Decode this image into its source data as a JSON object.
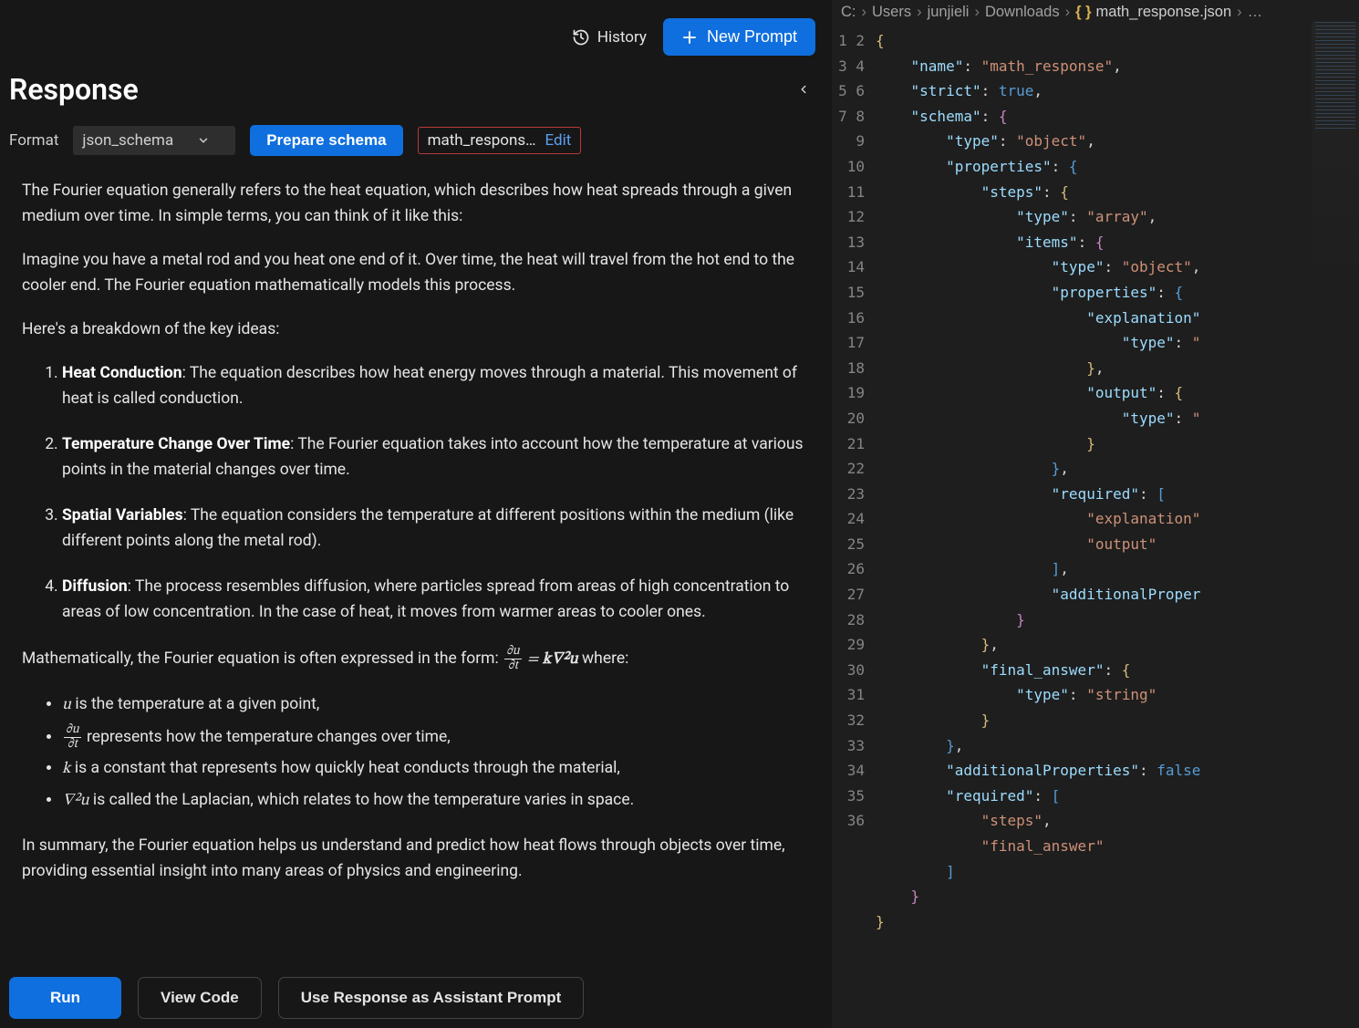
{
  "topbar": {
    "history_label": "History",
    "new_prompt_label": "New Prompt"
  },
  "header": {
    "title": "Response"
  },
  "format": {
    "label": "Format",
    "selected": "json_schema",
    "prepare_label": "Prepare schema",
    "schema_name": "math_respons…",
    "edit_label": "Edit"
  },
  "content": {
    "p1": "The Fourier equation generally refers to the heat equation, which describes how heat spreads through a given medium over time. In simple terms, you can think of it like this:",
    "p2": "Imagine you have a metal rod and you heat one end of it. Over time, the heat will travel from the hot end to the cooler end. The Fourier equation mathematically models this process.",
    "p3": "Here's a breakdown of the key ideas:",
    "items": [
      {
        "bold": "Heat Conduction",
        "rest": ": The equation describes how heat energy moves through a material. This movement of heat is called conduction."
      },
      {
        "bold": "Temperature Change Over Time",
        "rest": ": The Fourier equation takes into account how the temperature at various points in the material changes over time."
      },
      {
        "bold": "Spatial Variables",
        "rest": ": The equation considers the temperature at different positions within the medium (like different points along the metal rod)."
      },
      {
        "bold": "Diffusion",
        "rest": ": The process resembles diffusion, where particles spread from areas of high concentration to areas of low concentration. In the case of heat, it moves from warmer areas to cooler ones."
      }
    ],
    "p4_pre": "Mathematically, the Fourier equation is often expressed in the form: ",
    "p4_post": " where:",
    "eq": {
      "lhs_num": "∂u",
      "lhs_den": "∂t",
      "rhs": "k∇²u"
    },
    "bullets": [
      {
        "pre": "",
        "sym": "u",
        "post": " is the temperature at a given point,"
      },
      {
        "pre": "",
        "frac_num": "∂u",
        "frac_den": "∂t",
        "post": " represents how the temperature changes over time,"
      },
      {
        "pre": "",
        "sym": "k",
        "post": " is a constant that represents how quickly heat conducts through the material,"
      },
      {
        "pre": "",
        "sym": "∇²u",
        "post": " is called the Laplacian, which relates to how the temperature varies in space."
      }
    ],
    "p5": "In summary, the Fourier equation helps us understand and predict how heat flows through objects over time, providing essential insight into many areas of physics and engineering."
  },
  "buttons": {
    "run": "Run",
    "view_code": "View Code",
    "use_response": "Use Response as Assistant Prompt"
  },
  "editor": {
    "breadcrumbs": [
      "C:",
      "Users",
      "junjieli",
      "Downloads"
    ],
    "filename": "math_response.json",
    "trailing": "…",
    "line_count": 36,
    "code_lines": [
      [
        [
          "brace",
          "{"
        ]
      ],
      [
        [
          "sp",
          4
        ],
        [
          "key",
          "\"name\""
        ],
        [
          "punc",
          ": "
        ],
        [
          "str",
          "\"math_response\""
        ],
        [
          "punc",
          ","
        ]
      ],
      [
        [
          "sp",
          4
        ],
        [
          "key",
          "\"strict\""
        ],
        [
          "punc",
          ": "
        ],
        [
          "bool",
          "true"
        ],
        [
          "punc",
          ","
        ]
      ],
      [
        [
          "sp",
          4
        ],
        [
          "key",
          "\"schema\""
        ],
        [
          "punc",
          ": "
        ],
        [
          "brace2",
          "{"
        ]
      ],
      [
        [
          "sp",
          8
        ],
        [
          "key",
          "\"type\""
        ],
        [
          "punc",
          ": "
        ],
        [
          "str",
          "\"object\""
        ],
        [
          "punc",
          ","
        ]
      ],
      [
        [
          "sp",
          8
        ],
        [
          "key",
          "\"properties\""
        ],
        [
          "punc",
          ": "
        ],
        [
          "brace3",
          "{"
        ]
      ],
      [
        [
          "sp",
          12
        ],
        [
          "key",
          "\"steps\""
        ],
        [
          "punc",
          ": "
        ],
        [
          "brace",
          "{"
        ]
      ],
      [
        [
          "sp",
          16
        ],
        [
          "key",
          "\"type\""
        ],
        [
          "punc",
          ": "
        ],
        [
          "str",
          "\"array\""
        ],
        [
          "punc",
          ","
        ]
      ],
      [
        [
          "sp",
          16
        ],
        [
          "key",
          "\"items\""
        ],
        [
          "punc",
          ": "
        ],
        [
          "brace2",
          "{"
        ]
      ],
      [
        [
          "sp",
          20
        ],
        [
          "key",
          "\"type\""
        ],
        [
          "punc",
          ": "
        ],
        [
          "str",
          "\"object\""
        ],
        [
          "punc",
          ","
        ]
      ],
      [
        [
          "sp",
          20
        ],
        [
          "key",
          "\"properties\""
        ],
        [
          "punc",
          ": "
        ],
        [
          "brace3",
          "{"
        ]
      ],
      [
        [
          "sp",
          24
        ],
        [
          "key",
          "\"explanation\""
        ]
      ],
      [
        [
          "sp",
          28
        ],
        [
          "key",
          "\"type\""
        ],
        [
          "punc",
          ": "
        ],
        [
          "str",
          "\""
        ]
      ],
      [
        [
          "sp",
          24
        ],
        [
          "brace",
          "}"
        ],
        [
          "punc",
          ","
        ]
      ],
      [
        [
          "sp",
          24
        ],
        [
          "key",
          "\"output\""
        ],
        [
          "punc",
          ": "
        ],
        [
          "brace",
          "{"
        ]
      ],
      [
        [
          "sp",
          28
        ],
        [
          "key",
          "\"type\""
        ],
        [
          "punc",
          ": "
        ],
        [
          "str",
          "\""
        ]
      ],
      [
        [
          "sp",
          24
        ],
        [
          "brace",
          "}"
        ]
      ],
      [
        [
          "sp",
          20
        ],
        [
          "brace3",
          "}"
        ],
        [
          "punc",
          ","
        ]
      ],
      [
        [
          "sp",
          20
        ],
        [
          "key",
          "\"required\""
        ],
        [
          "punc",
          ": "
        ],
        [
          "brace3",
          "["
        ]
      ],
      [
        [
          "sp",
          24
        ],
        [
          "str",
          "\"explanation\""
        ]
      ],
      [
        [
          "sp",
          24
        ],
        [
          "str",
          "\"output\""
        ]
      ],
      [
        [
          "sp",
          20
        ],
        [
          "brace3",
          "]"
        ],
        [
          "punc",
          ","
        ]
      ],
      [
        [
          "sp",
          20
        ],
        [
          "key",
          "\"additionalProper"
        ]
      ],
      [
        [
          "sp",
          16
        ],
        [
          "brace2",
          "}"
        ]
      ],
      [
        [
          "sp",
          12
        ],
        [
          "brace",
          "}"
        ],
        [
          "punc",
          ","
        ]
      ],
      [
        [
          "sp",
          12
        ],
        [
          "key",
          "\"final_answer\""
        ],
        [
          "punc",
          ": "
        ],
        [
          "brace",
          "{"
        ]
      ],
      [
        [
          "sp",
          16
        ],
        [
          "key",
          "\"type\""
        ],
        [
          "punc",
          ": "
        ],
        [
          "str",
          "\"string\""
        ]
      ],
      [
        [
          "sp",
          12
        ],
        [
          "brace",
          "}"
        ]
      ],
      [
        [
          "sp",
          8
        ],
        [
          "brace3",
          "}"
        ],
        [
          "punc",
          ","
        ]
      ],
      [
        [
          "sp",
          8
        ],
        [
          "key",
          "\"additionalProperties\""
        ],
        [
          "punc",
          ": "
        ],
        [
          "bool",
          "false"
        ]
      ],
      [
        [
          "sp",
          8
        ],
        [
          "key",
          "\"required\""
        ],
        [
          "punc",
          ": "
        ],
        [
          "brace3",
          "["
        ]
      ],
      [
        [
          "sp",
          12
        ],
        [
          "str",
          "\"steps\""
        ],
        [
          "punc",
          ","
        ]
      ],
      [
        [
          "sp",
          12
        ],
        [
          "str",
          "\"final_answer\""
        ]
      ],
      [
        [
          "sp",
          8
        ],
        [
          "brace3",
          "]"
        ]
      ],
      [
        [
          "sp",
          4
        ],
        [
          "brace2",
          "}"
        ]
      ],
      [
        [
          "brace",
          "}"
        ]
      ]
    ]
  }
}
